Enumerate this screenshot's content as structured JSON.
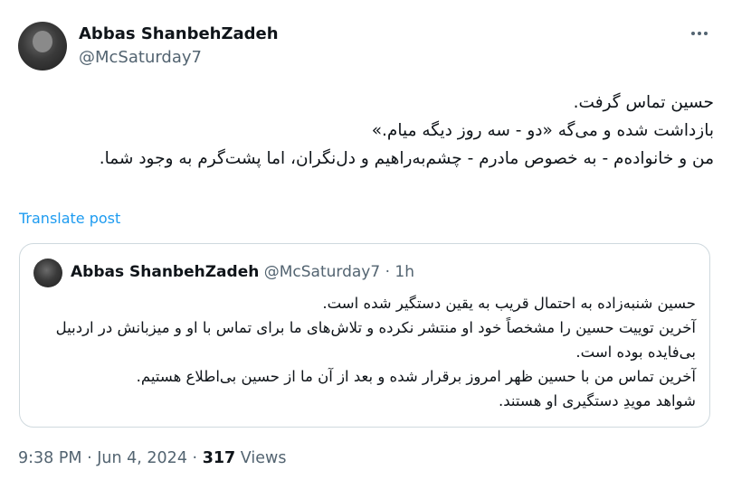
{
  "author": {
    "name": "Abbas ShanbehZadeh",
    "handle": "@McSaturday7"
  },
  "post": {
    "lines": [
      "حسین تماس گرفت.",
      "بازداشت شده و می‌گه «دو - سه روز دیگه میام.»",
      "من و خانواده‌م - به خصوص مادرم - چشم‌به‌راهیم و دل‌نگران، اما پشت‌گرم به وجود شما."
    ],
    "translate_label": "Translate post"
  },
  "quote": {
    "name": "Abbas ShanbehZadeh",
    "handle": "@McSaturday7",
    "separator": "·",
    "time": "1h",
    "lines": [
      "حسین شنبه‌زاده به احتمال قریب به یقین دستگیر شده است.",
      "آخرین توییت حسین را مشخصاً خود او منتشر نکرده و تلاش‌های ما برای تماس با او و میزبانش در اردبیل بی‌فایده بوده است.",
      "آخرین تماس من با حسین ظهر امروز برقرار شده و بعد از آن ما از حسین بی‌اطلاع هستیم.",
      "شواهد مویدِ دستگیری او هستند."
    ]
  },
  "meta": {
    "time": "9:38 PM",
    "separator": "·",
    "date": "Jun 4, 2024",
    "views_count": "317",
    "views_label": "Views"
  },
  "icons": {
    "more": "more-horizontal-icon"
  },
  "colors": {
    "link": "#1d9bf0",
    "secondary_text": "#536471",
    "border": "#cfd9de"
  }
}
